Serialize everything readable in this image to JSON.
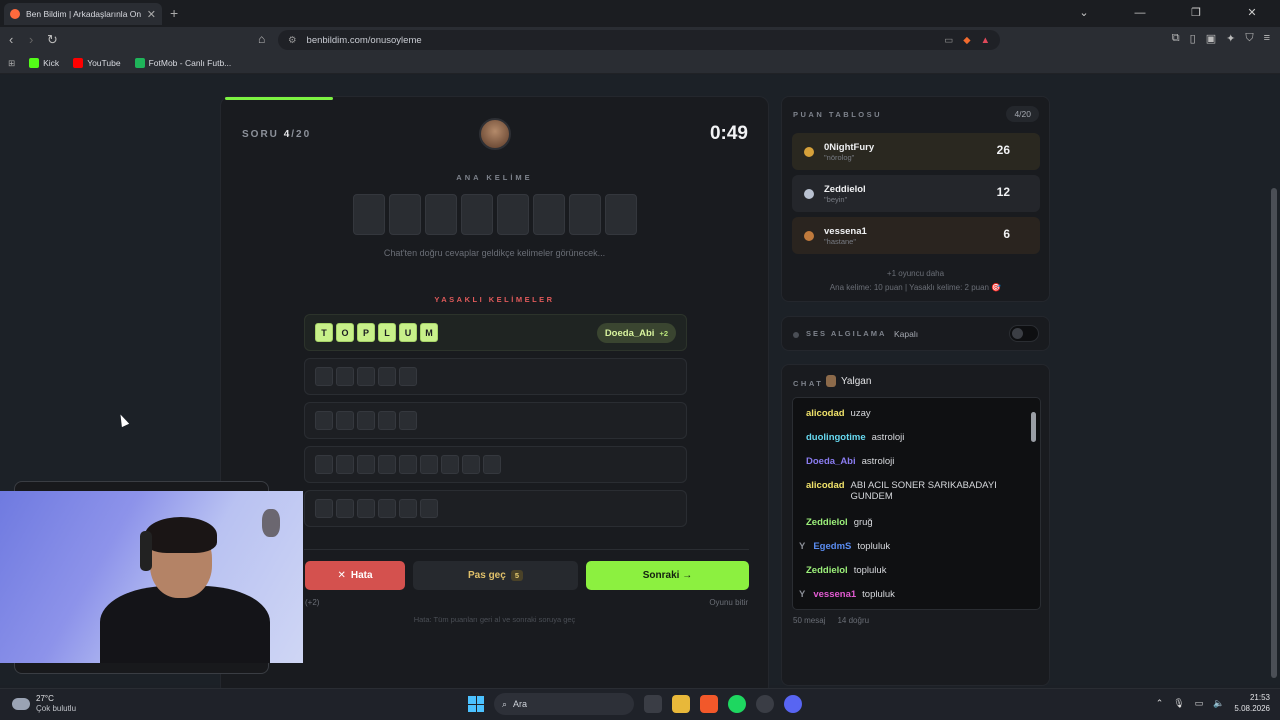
{
  "browser": {
    "tab_title": "Ben Bildim | Arkadaşlarınla Onlin",
    "url": "benbildim.com/onusoyleme",
    "bookmarks": [
      "Kick",
      "YouTube",
      "FotMob - Canlı Futb..."
    ]
  },
  "game": {
    "progress_fraction": 0.2,
    "soru_label": "SORU",
    "soru_current": "4",
    "soru_total": "/20",
    "timer": "0:49",
    "ana_kelime_label": "ANA KELİME",
    "ana_kelime_slots": 8,
    "hint": "Chat'ten doğru cevaplar geldikçe kelimeler görünecek...",
    "yasakli_label": "YASAKLI KELİMELER",
    "found_word": {
      "letters": [
        "T",
        "O",
        "P",
        "L",
        "U",
        "M"
      ],
      "user": "Doeda_Abi",
      "bonus": "+2"
    },
    "hidden_rows": [
      5,
      5,
      9,
      6
    ],
    "buttons": {
      "hata": "Hata",
      "pas": "Pas geç",
      "pas_count": "5",
      "sonraki": "Sonraki →"
    },
    "below_left": "(+2)",
    "below_right": "Oyunu bitir",
    "note": "Hata: Tüm puanları geri al ve sonraki soruya geç"
  },
  "scoreboard": {
    "title": "PUAN TABLOSU",
    "count": "4/20",
    "players": [
      {
        "name": "0NightFury",
        "word": "\"nörolog\"",
        "score": "26",
        "medal": "#d6a13a"
      },
      {
        "name": "Zeddielol",
        "word": "\"beyin\"",
        "score": "12",
        "medal": "#b9c1d0"
      },
      {
        "name": "vessena1",
        "word": "\"hastane\"",
        "score": "6",
        "medal": "#c07a3c"
      }
    ],
    "more": "+1 oyuncu daha",
    "points_info": "Ana kelime: 10 puan | Yasaklı kelime: 2 puan 🎯"
  },
  "voice": {
    "label": "SES ALGILAMA",
    "state": "Kapalı"
  },
  "chat": {
    "label": "CHAT",
    "channel": "Yalgan",
    "messages": [
      {
        "user": "alicodad",
        "text": "uzay",
        "color": "#f0e26a"
      },
      {
        "user": "duolingotime",
        "text": "astroloji",
        "color": "#67d9f0"
      },
      {
        "user": "Doeda_Abi",
        "text": "astroloji",
        "color": "#8a7cf0"
      },
      {
        "user": "alicodad",
        "text": "ABI ACIL SONER SARIKABADAYI",
        "text2": "GUNDEM",
        "color": "#f0e26a"
      },
      {
        "user": "Zeddielol",
        "text": "gruğ",
        "color": "#9cf07a"
      },
      {
        "user": "EgedmS",
        "text": "topluluk",
        "color": "#5a8cf0",
        "prefix": "Y"
      },
      {
        "user": "Zeddielol",
        "text": "topluluk",
        "color": "#9cf07a"
      },
      {
        "user": "vessena1",
        "text": "topluluk",
        "color": "#e05ad0",
        "prefix": "Y"
      }
    ],
    "footer_count": "50 mesaj",
    "footer_correct": "14 doğru"
  },
  "taskbar": {
    "temp": "27°C",
    "weather": "Çok bulutlu",
    "search": "Ara",
    "time": "21:53",
    "date": "5.08.2026"
  }
}
